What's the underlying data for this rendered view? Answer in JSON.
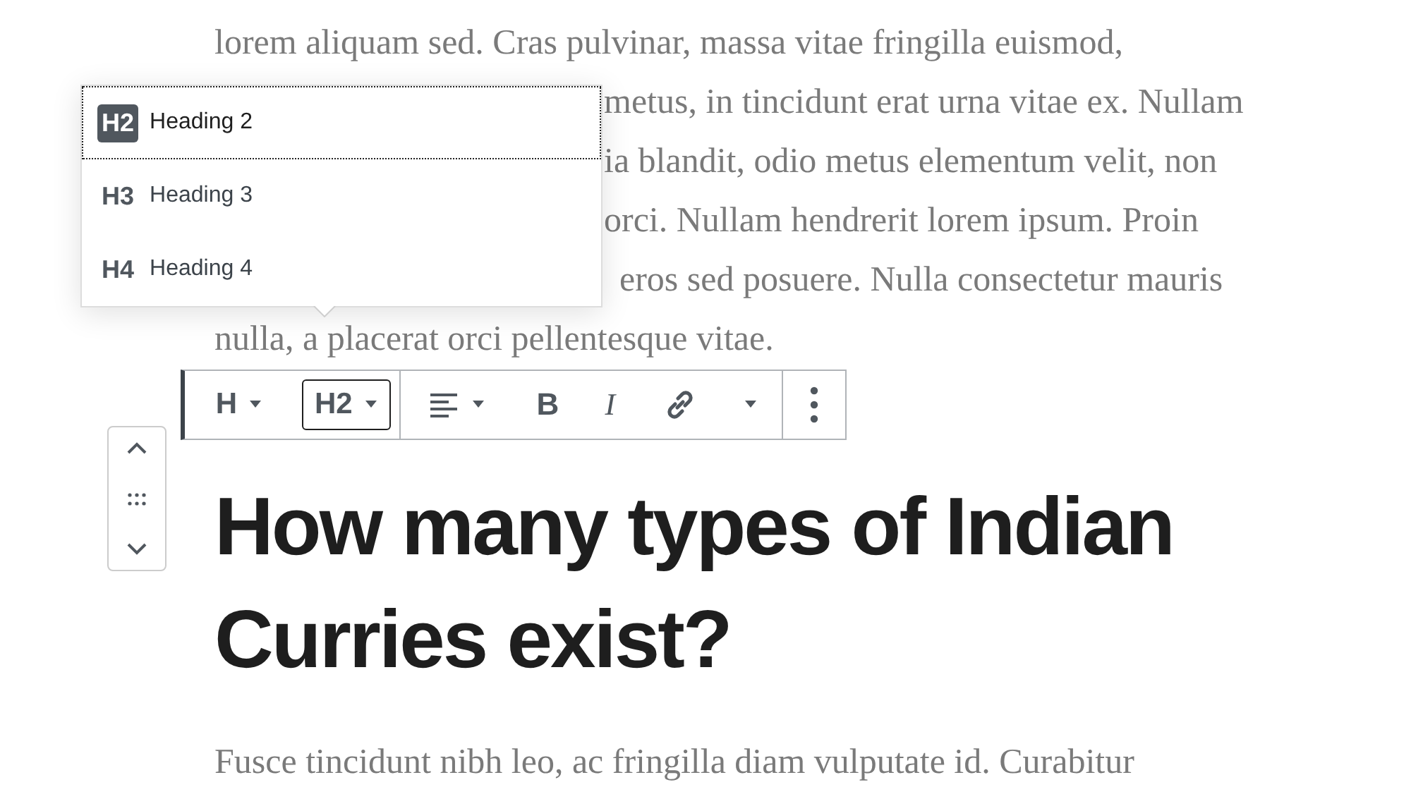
{
  "paragraph_lines": [
    {
      "text": "lorem aliquam sed. Cras pulvinar, massa vitae fringilla euismod,"
    },
    {
      "text": "metus, in tincidunt erat urna vitae ex. Nullam"
    },
    {
      "text": "ia blandit, odio metus elementum velit, non"
    },
    {
      "text": "orci. Nullam hendrerit lorem ipsum. Proin"
    },
    {
      "text": "eros sed posuere. Nulla consectetur mauris"
    },
    {
      "text": "nulla, a placerat orci pellentesque vitae."
    }
  ],
  "heading_menu": [
    {
      "badge": "H2",
      "label": "Heading 2",
      "selected": true
    },
    {
      "badge": "H3",
      "label": "Heading 3",
      "selected": false
    },
    {
      "badge": "H4",
      "label": "Heading 4",
      "selected": false
    }
  ],
  "toolbar": {
    "block_type": "H",
    "heading_level": "H2",
    "level_open": true,
    "bold": "B",
    "italic": "I"
  },
  "heading": [
    "How many types of Indian",
    "Curries exist?"
  ],
  "next_paragraph": "Fusce tincidunt nibh leo, ac fringilla diam vulputate id. Curabitur"
}
